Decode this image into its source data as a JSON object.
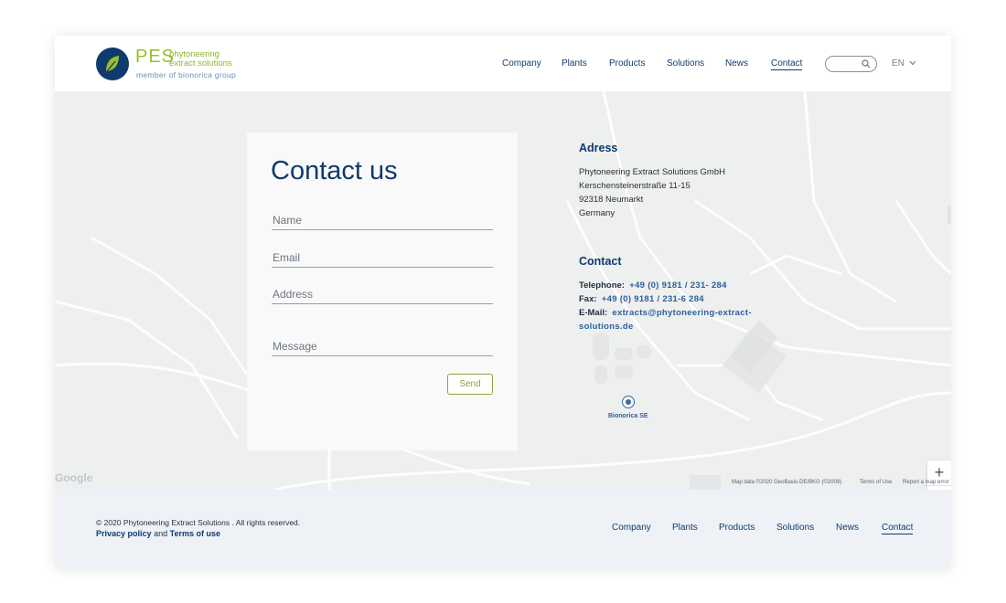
{
  "logo": {
    "mark": "PES",
    "line1": "phytoneering",
    "line2": "extract solutions",
    "line3": "member of bionorica group"
  },
  "nav": {
    "items": [
      "Company",
      "Plants",
      "Products",
      "Solutions",
      "News",
      "Contact"
    ],
    "active": "Contact"
  },
  "header": {
    "search_icon": "search-icon",
    "language": "EN"
  },
  "form": {
    "title": "Contact us",
    "fields": {
      "name": "Name",
      "email": "Email",
      "address": "Address",
      "message": "Message"
    },
    "send_label": "Send"
  },
  "address": {
    "heading": "Adress",
    "lines": [
      "Phytoneering Extract Solutions GmbH",
      "Kerschensteinerstraße 11-15",
      "92318 Neumarkt",
      "Germany"
    ]
  },
  "contact": {
    "heading": "Contact",
    "telephone_label": "Telephone:",
    "telephone": "+49 (0) 9181 / 231- 284",
    "fax_label": "Fax:",
    "fax": "+49 (0) 9181 / 231-6 284",
    "email_label": "E-Mail:",
    "email_1": "extracts@phytoneering-extract-",
    "email_2": "solutions.de"
  },
  "map": {
    "marker_label": "Bionorica SE",
    "google": "Google",
    "attribution": "Map data ©2020 GeoBasis-DE/BKG (©2009)",
    "terms": "Terms of Use",
    "report": "Report a map error",
    "zoom_in": "+",
    "zoom_out": "−"
  },
  "footer": {
    "copyright": "© 2020 Phytoneering Extract Solutions . All rights reserved.",
    "privacy": "Privacy policy",
    "and": "and",
    "terms": "Terms of use",
    "nav": [
      "Company",
      "Plants",
      "Products",
      "Solutions",
      "News",
      "Contact"
    ],
    "active": "Contact"
  },
  "colors": {
    "brand_blue": "#0f3a6e",
    "brand_green": "#9bbd2b",
    "link_blue": "#2d5f9a"
  }
}
